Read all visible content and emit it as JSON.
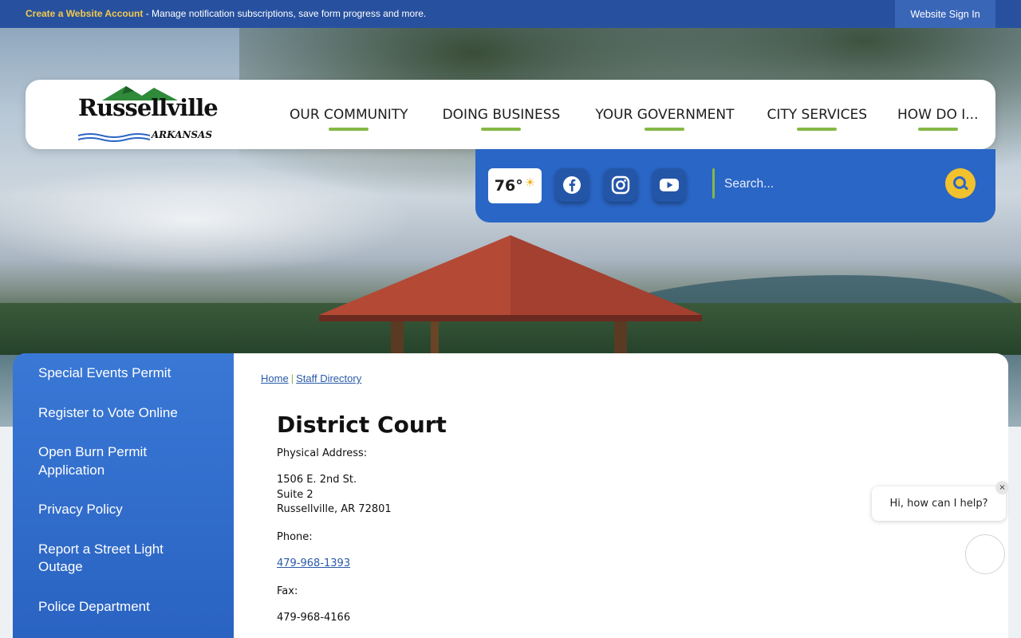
{
  "topbar": {
    "create_account_link": "Create a Website Account",
    "create_account_text": " - Manage notification subscriptions, save form progress and more.",
    "sign_in": "Website Sign In"
  },
  "logo": {
    "word": "Russellville",
    "state": "ARKANSAS"
  },
  "nav": {
    "items": [
      {
        "label": "OUR COMMUNITY"
      },
      {
        "label": "DOING BUSINESS"
      },
      {
        "label": "YOUR GOVERNMENT"
      },
      {
        "label": "CITY SERVICES"
      },
      {
        "label": "HOW DO I..."
      }
    ]
  },
  "utility": {
    "temperature": "76°",
    "social": [
      {
        "icon": "facebook-icon"
      },
      {
        "icon": "instagram-icon"
      },
      {
        "icon": "youtube-icon"
      }
    ],
    "search_placeholder": "Search..."
  },
  "sidebar": {
    "items": [
      {
        "label": "Special Events Permit"
      },
      {
        "label": "Register to Vote Online"
      },
      {
        "label": "Open Burn Permit Application"
      },
      {
        "label": "Privacy Policy"
      },
      {
        "label": "Report a Street Light Outage"
      },
      {
        "label": "Police Department"
      }
    ]
  },
  "breadcrumb": {
    "home": "Home",
    "separator": "|",
    "current": "Staff Directory"
  },
  "main": {
    "title": "District Court",
    "address_label": "Physical Address:",
    "address_line1": "1506 E. 2nd St.",
    "address_line2": "Suite 2",
    "address_line3": "Russellville, AR 72801",
    "phone_label": "Phone:",
    "phone": "479-968-1393",
    "fax_label": "Fax:",
    "fax": "479-968-4166"
  },
  "chat": {
    "prompt": "Hi, how can I help?",
    "close": "×"
  },
  "colors": {
    "accent_green": "#86b846",
    "brand_blue": "#2a66c6",
    "topbar_blue": "#27519f",
    "search_yellow": "#f2c12e"
  }
}
